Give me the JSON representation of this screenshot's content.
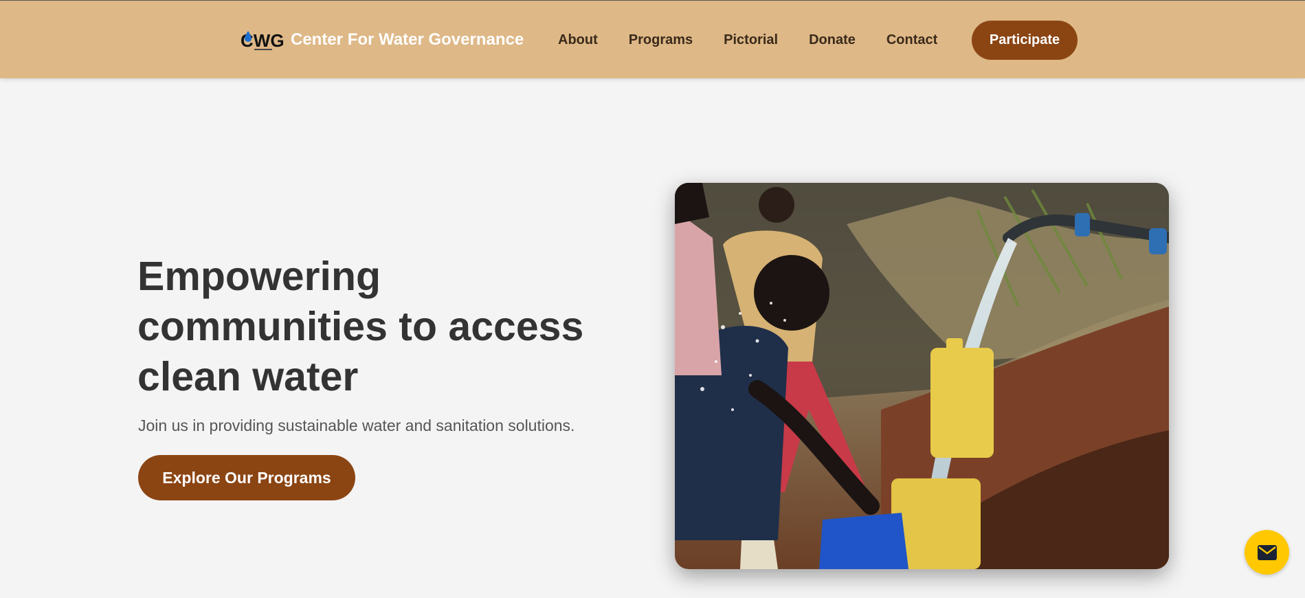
{
  "header": {
    "logo_text": "CWG",
    "brand_name": "Center For Water Governance",
    "nav": [
      "About",
      "Programs",
      "Pictorial",
      "Donate",
      "Contact"
    ],
    "participate_label": "Participate"
  },
  "hero": {
    "title": "Empowering communities to access clean water",
    "subtitle": "Join us in providing sustainable water and sanitation solutions.",
    "cta_label": "Explore Our Programs"
  },
  "floating": {
    "mail_icon": "envelope-icon"
  },
  "colors": {
    "header_bg": "#deb887",
    "accent_brown": "#8b4513",
    "fab_yellow": "#ffc800",
    "page_bg": "#f4f4f4",
    "heading_text": "#333333"
  }
}
